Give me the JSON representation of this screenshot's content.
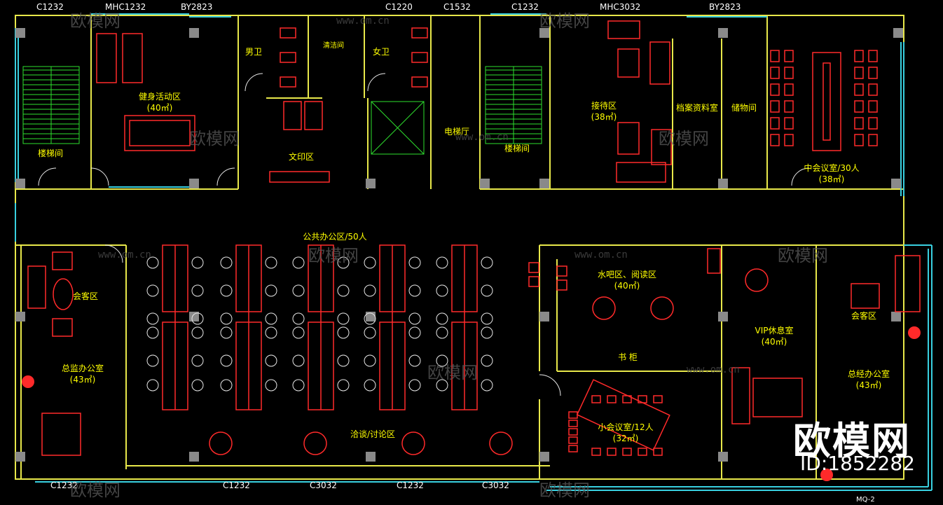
{
  "colors": {
    "background": "#000000",
    "wall": "#e8e84a",
    "window": "#39d0e0",
    "furniture": "#ff2a2a",
    "stair": "#2ee02e",
    "column": "#8a8a8a",
    "label": "#ffff00",
    "dim": "#ffffff",
    "watermark": "#ffffff"
  },
  "window_tags": {
    "top": [
      "C1232",
      "MHC1232",
      "BY2823",
      "C1220",
      "C1532",
      "C1232",
      "MHC3032",
      "BY2823"
    ],
    "bottom": [
      "C1232",
      "C1232",
      "C3032",
      "C1232",
      "C3032"
    ],
    "corner": "MQ-2"
  },
  "rooms": {
    "fitness": {
      "name": "健身活动区",
      "area": "(40㎡)"
    },
    "stair_left": {
      "name": "楼梯间"
    },
    "men_wc": {
      "name": "男卫"
    },
    "janitor": {
      "name": "清洁间"
    },
    "women_wc": {
      "name": "女卫"
    },
    "print": {
      "name": "文印区"
    },
    "elevator": {
      "name": "电梯厅"
    },
    "stair_right": {
      "name": "楼梯间"
    },
    "reception": {
      "name": "接待区",
      "area": "(38㎡)"
    },
    "archive": {
      "name": "档案资料室"
    },
    "storage": {
      "name": "储物间"
    },
    "meeting_mid": {
      "name": "中会议室/30人",
      "area": "(38㎡)"
    },
    "open_office": {
      "name": "公共办公区/50人"
    },
    "guest_left": {
      "name": "会客区"
    },
    "director_office": {
      "name": "总监办公室",
      "area": "(43㎡)"
    },
    "discussion": {
      "name": "洽谈/讨论区"
    },
    "water_bar": {
      "name": "水吧区、阅读区",
      "area": "(40㎡)"
    },
    "bookshelf": {
      "name": "书  柜"
    },
    "meeting_small": {
      "name": "小会议室/12人",
      "area": "(32㎡)"
    },
    "vip_lounge": {
      "name": "VIP休息室",
      "area": "(40㎡)"
    },
    "guest_right": {
      "name": "会客区"
    },
    "gm_office": {
      "name": "总经办公室",
      "area": "(43㎡)"
    }
  },
  "watermark": {
    "brand": "欧模网",
    "id": "ID:1852282",
    "ghost_text": "欧模网",
    "ghost_url": "www.om.cn"
  }
}
